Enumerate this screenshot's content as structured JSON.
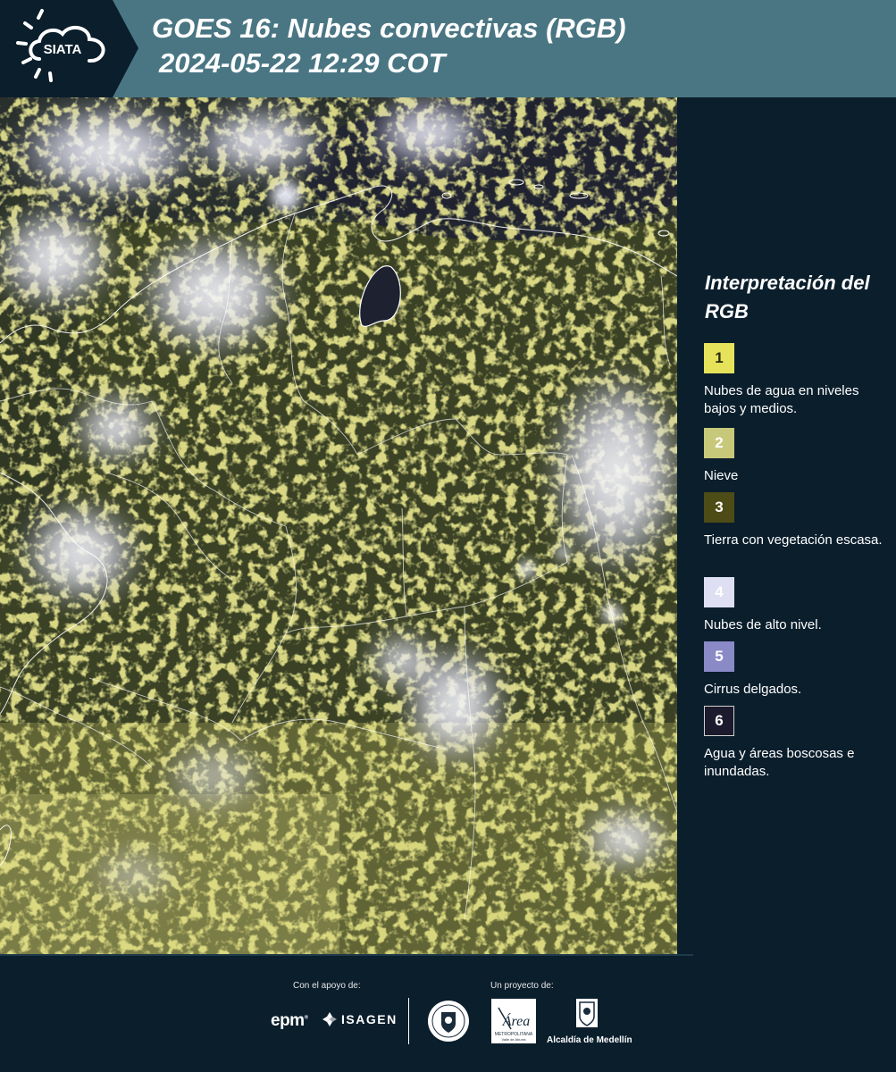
{
  "header": {
    "logo_text": "SIATA",
    "title_line1": "GOES 16: Nubes convectivas (RGB)",
    "title_line2": "2024-05-22 12:29 COT",
    "background_color": "#4a7683"
  },
  "legend": {
    "title": "Interpretación del RGB",
    "items": [
      {
        "number": "1",
        "label": "Nubes de agua en niveles bajos y medios.",
        "color": "#e6e35a"
      },
      {
        "number": "2",
        "label": "Nieve",
        "color": "#c8c87a"
      },
      {
        "number": "3",
        "label": "Tierra con vegetación escasa.",
        "color": "#4d4b16"
      },
      {
        "number": "4",
        "label": "Nubes de alto nivel.",
        "color": "#dedff2"
      },
      {
        "number": "5",
        "label": "Cirrus delgados.",
        "color": "#8a8ac7"
      },
      {
        "number": "6",
        "label": "Agua y áreas boscosas e inundadas.",
        "color": "#1b1b2d"
      }
    ]
  },
  "footer": {
    "support_label": "Con el apoyo de:",
    "project_label": "Un proyecto de:",
    "epm": "epm",
    "isagen": "ISAGEN",
    "area_text": "Área",
    "area_subtext": "METROPOLITANA",
    "area_subtext2": "Valle de Aburrá",
    "alcaldia": "Alcaldía de Medellín"
  }
}
